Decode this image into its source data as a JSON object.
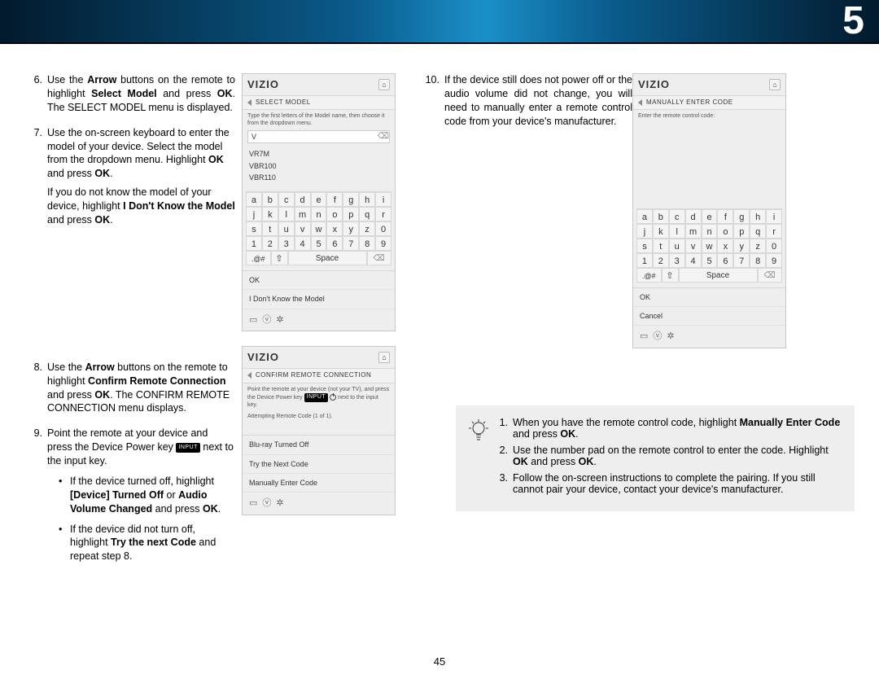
{
  "header": {
    "chapter_num": "5"
  },
  "page_number": "45",
  "col1": {
    "step6": {
      "num": "6.",
      "pre": "Use the ",
      "b1": "Arrow",
      "mid1": " buttons on the remote to highlight ",
      "b2": "Select Model",
      "mid2": " and press ",
      "b3": "OK",
      "post": ". The SELECT MODEL menu is displayed."
    },
    "step7": {
      "num": "7.",
      "line1": "Use the on-screen keyboard to enter the model of your device. Select the model from the dropdown menu. Highlight ",
      "b1": "OK",
      "mid1": " and press ",
      "b2": "OK",
      "post1": ".",
      "cond_pre": "If you do not know the model of your device, highlight ",
      "cond_b": "I Don't Know the Model",
      "cond_mid": " and press ",
      "cond_b2": "OK",
      "cond_post": "."
    },
    "step8": {
      "num": "8.",
      "pre": "Use the ",
      "b1": "Arrow",
      "mid1": " buttons on the remote to highlight ",
      "b2": "Confirm Remote Connection",
      "mid2": " and press ",
      "b3": "OK",
      "post": ". The CONFIRM REMOTE CONNECTION menu displays."
    },
    "step9": {
      "num": "9.",
      "pre": "Point the remote at your device and press the Device Power key ",
      "input_chip": "INPUT",
      "post": " next to the input key.",
      "bullet1_pre": "If the device turned off, highlight ",
      "bullet1_b1": "[Device] Turned Off",
      "bullet1_mid": " or ",
      "bullet1_b2": "Audio Volume Changed",
      "bullet1_mid2": " and press ",
      "bullet1_b3": "OK",
      "bullet1_post": ".",
      "bullet2_pre": "If the device did not turn off, highlight ",
      "bullet2_b": "Try the next Code",
      "bullet2_post": " and repeat step 8."
    }
  },
  "col3": {
    "step10": {
      "num": "10.",
      "text": "If the device still does not power off or the audio volume did not change, you will need to manually enter a remote control code from your device's manufacturer."
    }
  },
  "tips": {
    "t1": {
      "num": "1.",
      "pre": "When you have the remote control code, highlight ",
      "b": "Manually Enter Code",
      "mid": " and press ",
      "b2": "OK",
      "post": "."
    },
    "t2": {
      "num": "2.",
      "pre": "Use the number pad on the remote control to enter the code. Highlight ",
      "b": "OK",
      "mid": " and press ",
      "b2": "OK",
      "post": "."
    },
    "t3": {
      "num": "3.",
      "text": "Follow the on-screen instructions to complete the pairing. If you still cannot pair your device, contact your device's manufacturer."
    }
  },
  "ui1": {
    "brand": "VIZIO",
    "crumb": "SELECT MODEL",
    "hint": "Type the first letters of the Model name, then choose it from the dropdown menu.",
    "field_value": "V",
    "models": [
      "VR7M",
      "VBR100",
      "VBR110"
    ],
    "space": "Space",
    "sym": ".@#",
    "menu": [
      "OK",
      "I Don't Know the Model"
    ]
  },
  "ui2": {
    "brand": "VIZIO",
    "crumb": "CONFIRM REMOTE CONNECTION",
    "hint1": "Point the remote at your device (not your TV), and press the Device Power key",
    "hint_input": "INPUT",
    "hint2": " next to the input key.",
    "attempt": "Attempting Remote Code (1 of 1).",
    "menu": [
      "Blu-ray Turned Off",
      "Try the Next Code",
      "Manually Enter Code"
    ]
  },
  "ui3": {
    "brand": "VIZIO",
    "crumb": "MANUALLY ENTER CODE",
    "hint": "Enter the remote control code:",
    "space": "Space",
    "sym": ".@#",
    "menu": [
      "OK",
      "Cancel"
    ]
  },
  "kbd": {
    "row1": [
      "a",
      "b",
      "c",
      "d",
      "e",
      "f",
      "g",
      "h",
      "i"
    ],
    "row2": [
      "j",
      "k",
      "l",
      "m",
      "n",
      "o",
      "p",
      "q",
      "r"
    ],
    "row3": [
      "s",
      "t",
      "u",
      "v",
      "w",
      "x",
      "y",
      "z",
      "0"
    ],
    "row4": [
      "1",
      "2",
      "3",
      "4",
      "5",
      "6",
      "7",
      "8",
      "9"
    ]
  }
}
